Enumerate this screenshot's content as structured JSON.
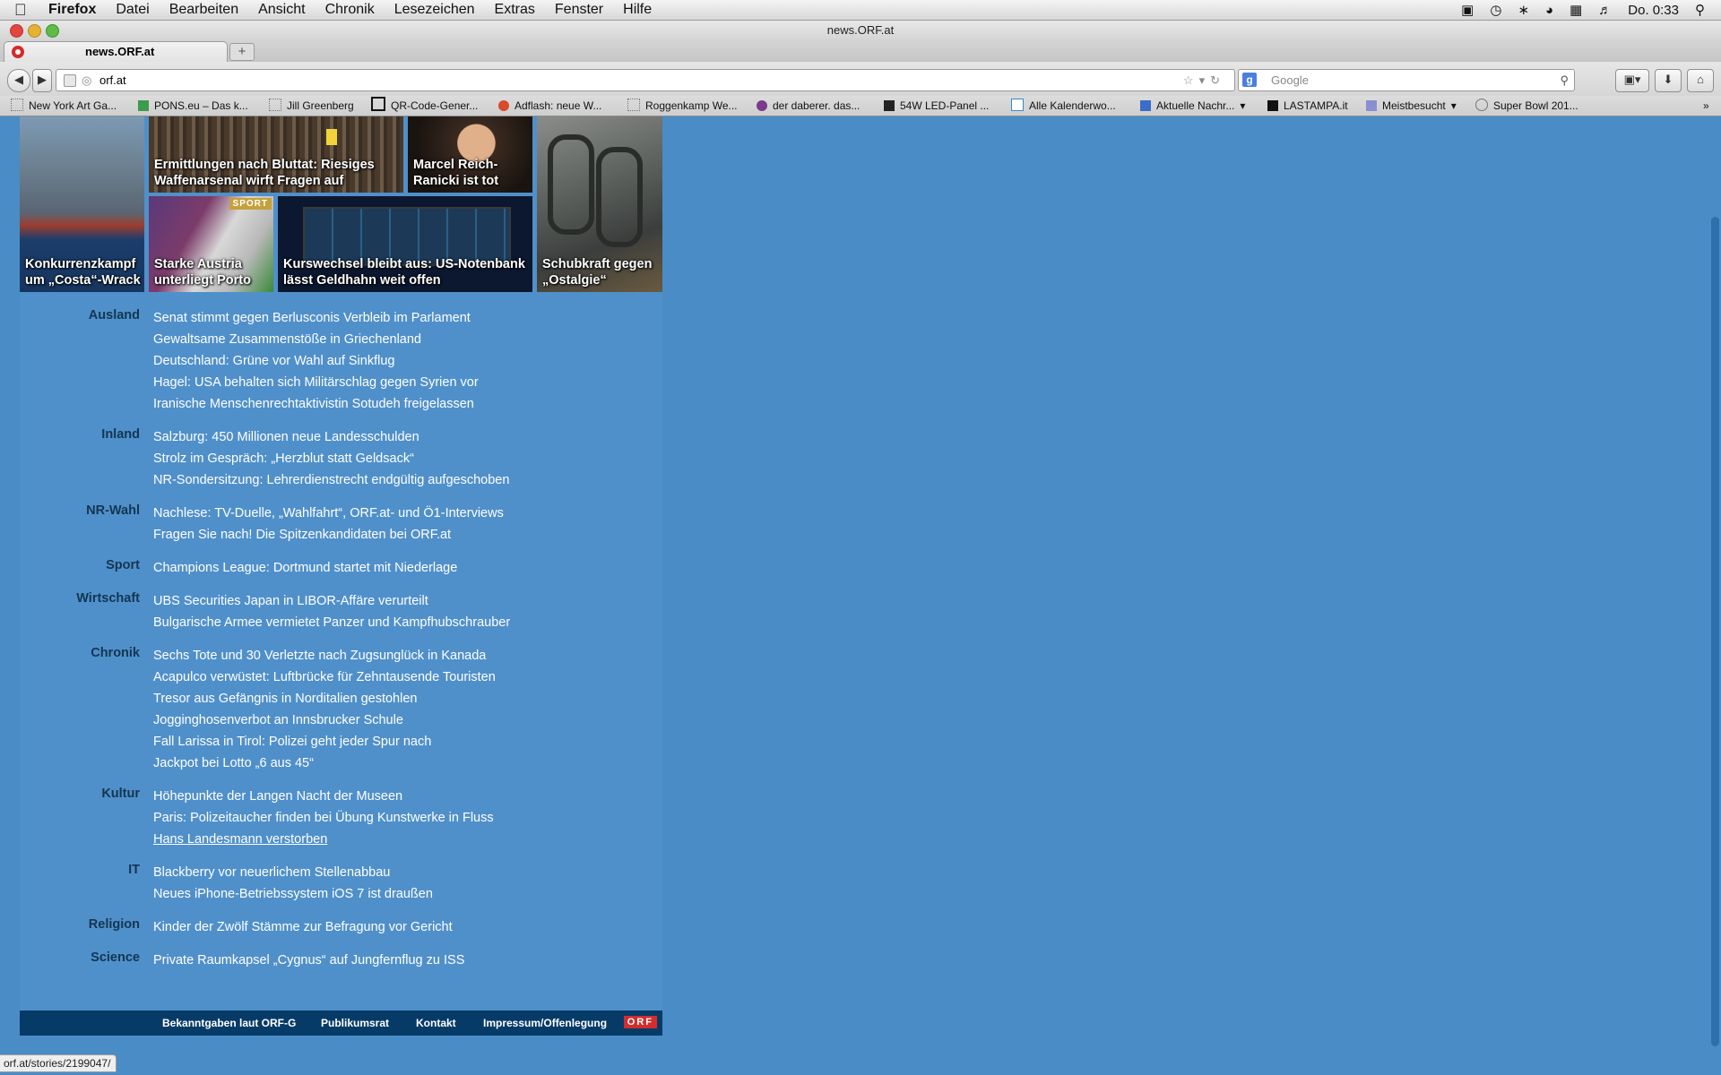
{
  "menubar": {
    "app": "Firefox",
    "items": [
      "Datei",
      "Bearbeiten",
      "Ansicht",
      "Chronik",
      "Lesezeichen",
      "Extras",
      "Fenster",
      "Hilfe"
    ],
    "clock": "Do. 0:33"
  },
  "window": {
    "title": "news.ORF.at"
  },
  "tab": {
    "label": "news.ORF.at"
  },
  "toolbar": {
    "url": "orf.at",
    "search_placeholder": "Google"
  },
  "bookmarks": [
    "New York Art Ga...",
    "PONS.eu – Das k...",
    "Jill Greenberg",
    "QR-Code-Gener...",
    "Adflash: neue W...",
    "Roggenkamp We...",
    "der daberer. das...",
    "54W LED-Panel ...",
    "Alle Kalenderwo...",
    "Aktuelle Nachr...",
    "LASTAMPA.it",
    "Meistbesucht",
    "Super Bowl 201..."
  ],
  "tiles": {
    "costa": "Konkurrenzkampf um „Costa“-Wrack",
    "waffen": "Ermittlungen nach Bluttat: Riesiges Waffenarsenal wirft Fragen auf",
    "ranicki": "Marcel Reich-Ranicki ist tot",
    "austria": "Starke Austria unterliegt Porto",
    "austria_badge": "SPORT",
    "kurs": "Kurswechsel bleibt aus: US-Notenbank lässt Geldhahn weit offen",
    "schub": "Schubkraft gegen „Ostalgie“"
  },
  "sections": [
    {
      "name": "Ausland",
      "items": [
        "Senat stimmt gegen Berlusconis Verbleib im Parlament",
        "Gewaltsame Zusammenstöße in Griechenland",
        "Deutschland: Grüne vor Wahl auf Sinkflug",
        "Hagel: USA behalten sich Militärschlag gegen Syrien vor",
        "Iranische Menschenrechtaktivistin Sotudeh freigelassen"
      ]
    },
    {
      "name": "Inland",
      "items": [
        "Salzburg: 450 Millionen neue Landesschulden",
        "Strolz im Gespräch: „Herzblut statt Geldsack“",
        "NR-Sondersitzung: Lehrerdienstrecht endgültig aufgeschoben"
      ]
    },
    {
      "name": "NR-Wahl",
      "items": [
        "Nachlese: TV-Duelle, „Wahlfahrt“, ORF.at- und Ö1-Interviews",
        "Fragen Sie nach! Die Spitzenkandidaten bei ORF.at"
      ]
    },
    {
      "name": "Sport",
      "items": [
        "Champions League: Dortmund startet mit Niederlage"
      ]
    },
    {
      "name": "Wirtschaft",
      "items": [
        "UBS Securities Japan in LIBOR-Affäre verurteilt",
        "Bulgarische Armee vermietet Panzer und Kampfhubschrauber"
      ]
    },
    {
      "name": "Chronik",
      "items": [
        "Sechs Tote und 30 Verletzte nach Zugsunglück in Kanada",
        "Acapulco verwüstet: Luftbrücke für Zehntausende Touristen",
        "Tresor aus Gefängnis in Norditalien gestohlen",
        "Jogginghosenverbot an Innsbrucker Schule",
        "Fall Larissa in Tirol: Polizei geht jeder Spur nach",
        "Jackpot bei Lotto „6 aus 45“"
      ]
    },
    {
      "name": "Kultur",
      "items": [
        "Höhepunkte der Langen Nacht der Museen",
        "Paris: Polizeitaucher finden bei Übung Kunstwerke in Fluss",
        "Hans Landesmann verstorben"
      ]
    },
    {
      "name": "IT",
      "items": [
        "Blackberry vor neuerlichem Stellenabbau",
        "Neues iPhone-Betriebssystem iOS 7 ist draußen"
      ]
    },
    {
      "name": "Religion",
      "items": [
        "Kinder der Zwölf Stämme zur Befragung vor Gericht"
      ]
    },
    {
      "name": "Science",
      "items": [
        "Private Raumkapsel „Cygnus“ auf Jungfernflug zu ISS"
      ]
    }
  ],
  "hovered_link": "Hans Landesmann verstorben",
  "footer": {
    "links": [
      "Bekanntgaben laut ORF-G",
      "Publikumsrat",
      "Kontakt",
      "Impressum/Offenlegung"
    ],
    "logo": "ORF"
  },
  "status_url": "orf.at/stories/2199047/"
}
